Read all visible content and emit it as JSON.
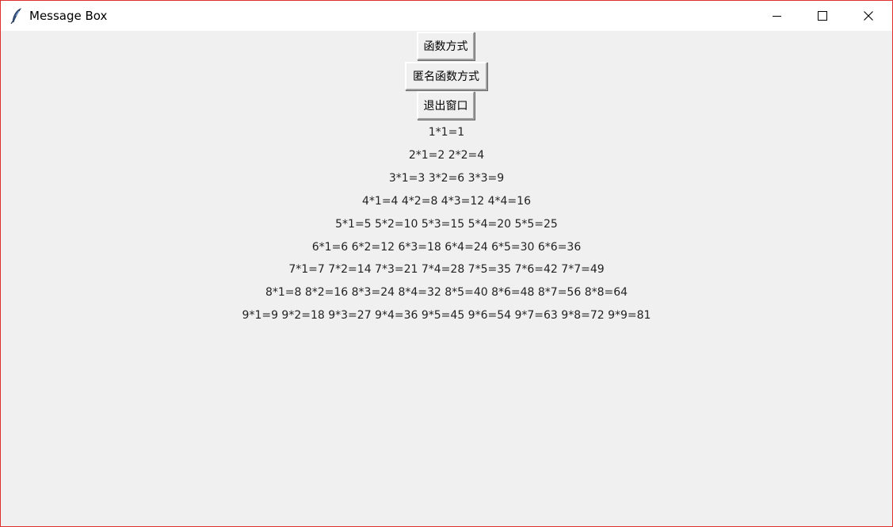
{
  "window": {
    "title": "Message Box",
    "icon": "feather-icon",
    "border_color": "#e0302e",
    "background": "#f0f0f0"
  },
  "titlebar_buttons": {
    "minimize": "minimize-icon",
    "maximize": "maximize-icon",
    "close": "close-icon"
  },
  "buttons": [
    {
      "label": "函数方式"
    },
    {
      "label": "匿名函数方式"
    },
    {
      "label": "退出窗口"
    }
  ],
  "table_rows": [
    "1*1=1",
    "2*1=2 2*2=4",
    "3*1=3 3*2=6 3*3=9",
    "4*1=4 4*2=8 4*3=12 4*4=16",
    "5*1=5 5*2=10 5*3=15 5*4=20 5*5=25",
    "6*1=6 6*2=12 6*3=18 6*4=24 6*5=30 6*6=36",
    "7*1=7 7*2=14 7*3=21 7*4=28 7*5=35 7*6=42 7*7=49",
    "8*1=8 8*2=16 8*3=24 8*4=32 8*5=40 8*6=48 8*7=56 8*8=64",
    "9*1=9 9*2=18 9*3=27 9*4=36 9*5=45 9*6=54 9*7=63 9*8=72 9*9=81"
  ]
}
